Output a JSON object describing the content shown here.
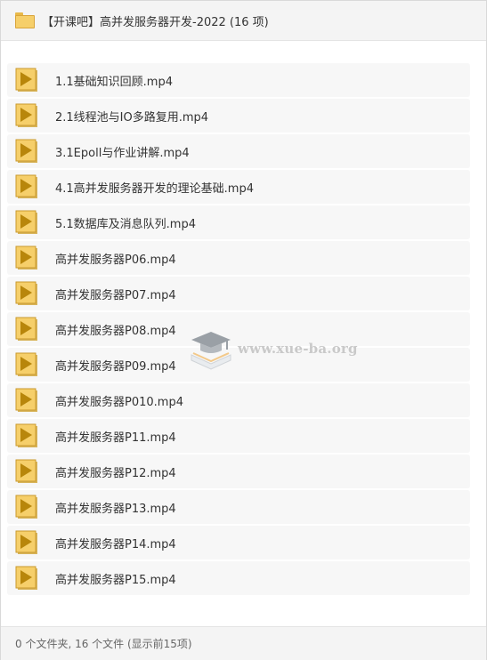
{
  "header": {
    "title": "【开课吧】高并发服务器开发-2022 (16 项)",
    "icon": "folder-icon"
  },
  "files": [
    {
      "name": "1.1基础知识回顾.mp4",
      "icon": "video-file-icon"
    },
    {
      "name": "2.1线程池与IO多路复用.mp4",
      "icon": "video-file-icon"
    },
    {
      "name": "3.1Epoll与作业讲解.mp4",
      "icon": "video-file-icon"
    },
    {
      "name": "4.1高并发服务器开发的理论基础.mp4",
      "icon": "video-file-icon"
    },
    {
      "name": "5.1数据库及消息队列.mp4",
      "icon": "video-file-icon"
    },
    {
      "name": "高并发服务器P06.mp4",
      "icon": "video-file-icon"
    },
    {
      "name": "高并发服务器P07.mp4",
      "icon": "video-file-icon"
    },
    {
      "name": "高并发服务器P08.mp4",
      "icon": "video-file-icon"
    },
    {
      "name": "高并发服务器P09.mp4",
      "icon": "video-file-icon"
    },
    {
      "name": "高并发服务器P010.mp4",
      "icon": "video-file-icon"
    },
    {
      "name": "高并发服务器P11.mp4",
      "icon": "video-file-icon"
    },
    {
      "name": "高并发服务器P12.mp4",
      "icon": "video-file-icon"
    },
    {
      "name": "高并发服务器P13.mp4",
      "icon": "video-file-icon"
    },
    {
      "name": "高并发服务器P14.mp4",
      "icon": "video-file-icon"
    },
    {
      "name": "高并发服务器P15.mp4",
      "icon": "video-file-icon"
    }
  ],
  "watermark": {
    "text": "www.xue-ba.org",
    "icon": "graduation-cap-book-icon"
  },
  "footer": {
    "status": "0 个文件夹, 16 个文件 (显示前15项)"
  },
  "colors": {
    "icon_fill": "#f6cf6a",
    "icon_border": "#c99a2e",
    "play_triangle": "#b8860b",
    "row_background": "#f7f7f7",
    "header_background": "#f4f4f4"
  }
}
